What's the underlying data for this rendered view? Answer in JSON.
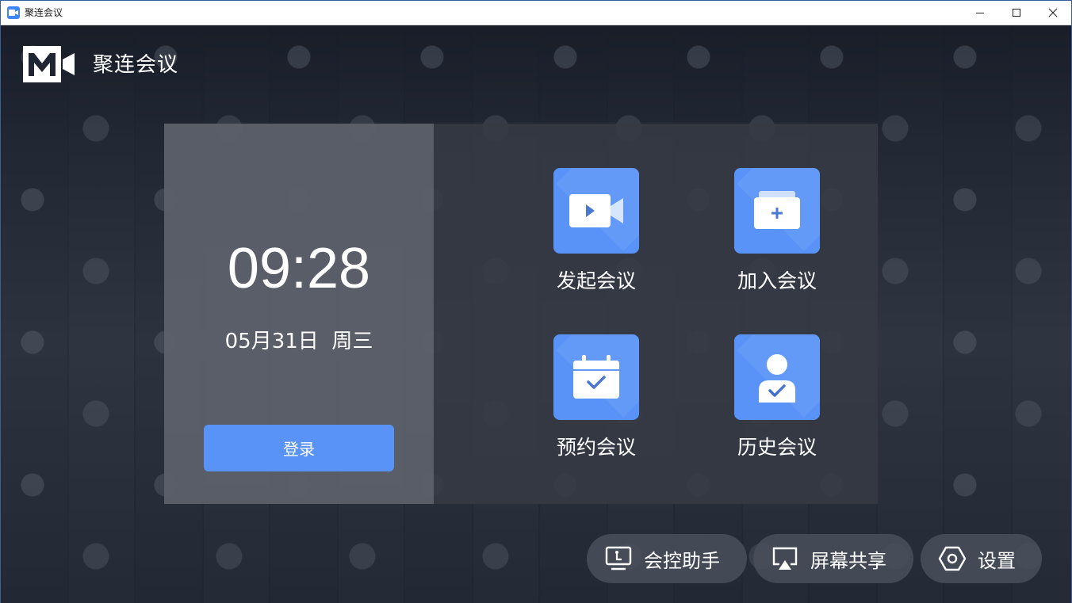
{
  "window": {
    "title": "聚连会议",
    "controls": [
      "minimize-icon",
      "maximize-icon",
      "close-icon"
    ]
  },
  "brand": {
    "name": "聚连会议",
    "logo_icon": "m-camera-logo-icon"
  },
  "clock_panel": {
    "time": "09:28",
    "date": "05月31日  周三",
    "login_label": "登录"
  },
  "actions": [
    {
      "label": "发起会议",
      "icon": "video-camera-icon"
    },
    {
      "label": "加入会议",
      "icon": "join-plus-icon"
    },
    {
      "label": "预约会议",
      "icon": "calendar-check-icon"
    },
    {
      "label": "历史会议",
      "icon": "user-check-icon"
    }
  ],
  "toolbar": {
    "assistant_label": "会控助手",
    "share_label": "屏幕共享",
    "settings_label": "设置"
  },
  "colors": {
    "accent": "#5a93f7",
    "background": "#1c2230",
    "panel_left": "#5c606a",
    "panel_right": "#363a44"
  }
}
